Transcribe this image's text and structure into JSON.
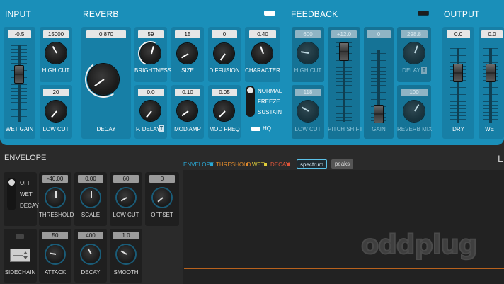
{
  "sections": {
    "input": "INPUT",
    "reverb": "REVERB",
    "feedback": "FEEDBACK",
    "output": "OUTPUT",
    "envelope": "ENVELOPE"
  },
  "input": {
    "wet_gain": {
      "label": "WET GAIN",
      "value": "-0.5"
    },
    "high_cut": {
      "label": "HIGH CUT",
      "value": "15000"
    },
    "low_cut": {
      "label": "LOW CUT",
      "value": "20"
    }
  },
  "reverb": {
    "decay": {
      "label": "DECAY",
      "value": "0.870"
    },
    "brightness": {
      "label": "BRIGHTNESS",
      "value": "59"
    },
    "size": {
      "label": "SIZE",
      "value": "15"
    },
    "diffusion": {
      "label": "DIFFUSION",
      "value": "0"
    },
    "character": {
      "label": "CHARACTER",
      "value": "0.40"
    },
    "p_delay": {
      "label": "P. DELAY",
      "value": "0.0",
      "badge": "T"
    },
    "mod_amp": {
      "label": "MOD AMP",
      "value": "0.10"
    },
    "mod_freq": {
      "label": "MOD FREQ",
      "value": "0.05"
    },
    "modes": [
      "NORMAL",
      "FREEZE",
      "SUSTAIN"
    ],
    "hq": "HQ"
  },
  "feedback": {
    "high_cut": {
      "label": "HIGH CUT",
      "value": "600"
    },
    "low_cut": {
      "label": "LOW CUT",
      "value": "118"
    },
    "pitch_shift": {
      "label": "PITCH SHIFT",
      "value": "+12.0"
    },
    "gain": {
      "label": "GAIN",
      "value": "0"
    },
    "delay": {
      "label": "DELAY",
      "value": "298.8",
      "badge": "T"
    },
    "reverb_mix": {
      "label": "REVERB MIX",
      "value": "100"
    }
  },
  "output": {
    "dry": {
      "label": "DRY",
      "value": "0.0"
    },
    "wet": {
      "label": "WET",
      "value": "0.0"
    }
  },
  "envelope": {
    "modes": [
      "OFF",
      "WET",
      "DECAY"
    ],
    "threshold": {
      "label": "THRESHOLD",
      "value": "-40.00"
    },
    "scale": {
      "label": "SCALE",
      "value": "0.00"
    },
    "low_cut": {
      "label": "LOW CUT",
      "value": "60"
    },
    "offset": {
      "label": "OFFSET",
      "value": "0"
    },
    "sidechain": {
      "label": "SIDECHAIN"
    },
    "attack": {
      "label": "ATTACK",
      "value": "50"
    },
    "decay": {
      "label": "DECAY",
      "value": "400"
    },
    "smooth": {
      "label": "SMOOTH",
      "value": "1.0"
    }
  },
  "graph": {
    "legend": [
      "ENVELOPE",
      "THRESHOLD",
      "WET",
      "DECAY"
    ],
    "views": [
      "spectrum",
      "peaks"
    ],
    "active_view": "spectrum",
    "logo": "oddplug",
    "edge_letter": "L"
  },
  "colors": {
    "panel": "#1a8fb9",
    "envelope_legend": "#2aa9d6",
    "threshold_legend": "#e08a2c",
    "wet_legend": "#e0cf3a",
    "decay_legend": "#e0553a",
    "threshold_line": "#b8621e"
  }
}
